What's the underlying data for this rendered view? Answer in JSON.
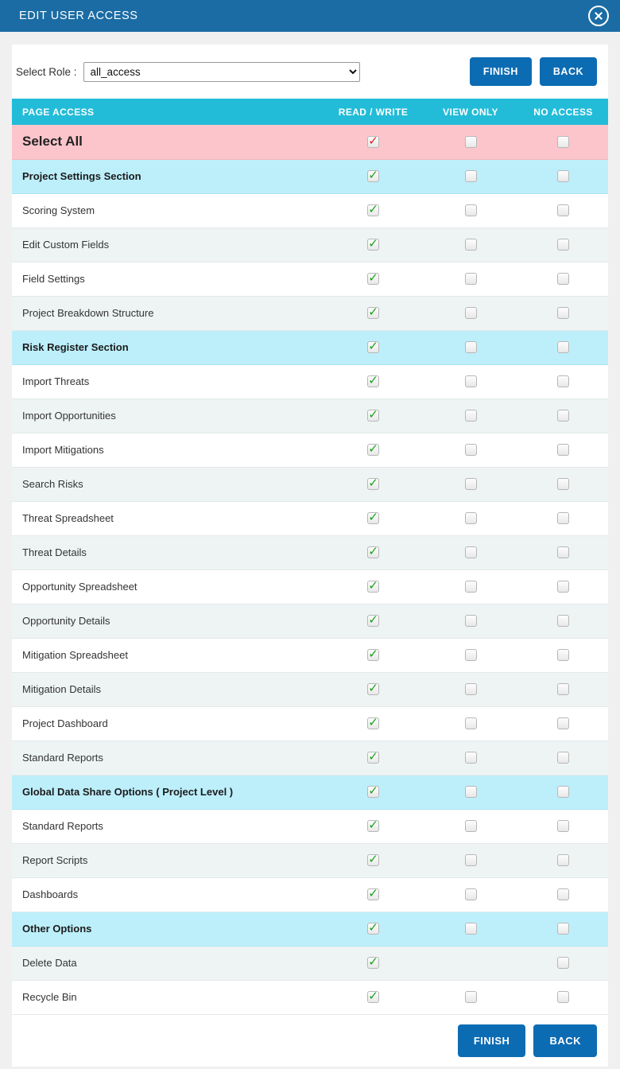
{
  "window": {
    "title": "EDIT USER ACCESS",
    "close_icon": "close-circle-icon",
    "titlebar_color": "#1b6ca4"
  },
  "toolbar": {
    "role_label": "Select Role :",
    "role_value": "all_access",
    "role_options": [
      "all_access"
    ],
    "finish_label": "FINISH",
    "back_label": "BACK",
    "button_color": "#0c6cb3"
  },
  "table": {
    "header_color": "#22bcd8",
    "section_row_color": "#bdeffb",
    "select_all_row_color": "#fbc5cb",
    "columns": [
      "PAGE ACCESS",
      "READ / WRITE",
      "VIEW ONLY",
      "NO ACCESS"
    ],
    "rows": [
      {
        "label": "Select All",
        "kind": "select-all",
        "read_write": true,
        "view_only": false,
        "no_access": false,
        "check_color": "#e02020",
        "has_view_only": true
      },
      {
        "label": "Project Settings Section",
        "kind": "section",
        "read_write": true,
        "view_only": false,
        "no_access": false,
        "check_color": "#18a318",
        "has_view_only": true
      },
      {
        "label": "Scoring System",
        "kind": "item",
        "read_write": true,
        "view_only": false,
        "no_access": false,
        "check_color": "#18a318",
        "has_view_only": true
      },
      {
        "label": "Edit Custom Fields",
        "kind": "item",
        "read_write": true,
        "view_only": false,
        "no_access": false,
        "check_color": "#18a318",
        "has_view_only": true
      },
      {
        "label": "Field Settings",
        "kind": "item",
        "read_write": true,
        "view_only": false,
        "no_access": false,
        "check_color": "#18a318",
        "has_view_only": true
      },
      {
        "label": "Project Breakdown Structure",
        "kind": "item",
        "read_write": true,
        "view_only": false,
        "no_access": false,
        "check_color": "#18a318",
        "has_view_only": true
      },
      {
        "label": "Risk Register Section",
        "kind": "section",
        "read_write": true,
        "view_only": false,
        "no_access": false,
        "check_color": "#18a318",
        "has_view_only": true
      },
      {
        "label": "Import Threats",
        "kind": "item",
        "read_write": true,
        "view_only": false,
        "no_access": false,
        "check_color": "#18a318",
        "has_view_only": true
      },
      {
        "label": "Import Opportunities",
        "kind": "item",
        "read_write": true,
        "view_only": false,
        "no_access": false,
        "check_color": "#18a318",
        "has_view_only": true
      },
      {
        "label": "Import Mitigations",
        "kind": "item",
        "read_write": true,
        "view_only": false,
        "no_access": false,
        "check_color": "#18a318",
        "has_view_only": true
      },
      {
        "label": "Search Risks",
        "kind": "item",
        "read_write": true,
        "view_only": false,
        "no_access": false,
        "check_color": "#18a318",
        "has_view_only": true
      },
      {
        "label": "Threat Spreadsheet",
        "kind": "item",
        "read_write": true,
        "view_only": false,
        "no_access": false,
        "check_color": "#18a318",
        "has_view_only": true
      },
      {
        "label": "Threat Details",
        "kind": "item",
        "read_write": true,
        "view_only": false,
        "no_access": false,
        "check_color": "#18a318",
        "has_view_only": true
      },
      {
        "label": "Opportunity Spreadsheet",
        "kind": "item",
        "read_write": true,
        "view_only": false,
        "no_access": false,
        "check_color": "#18a318",
        "has_view_only": true
      },
      {
        "label": "Opportunity Details",
        "kind": "item",
        "read_write": true,
        "view_only": false,
        "no_access": false,
        "check_color": "#18a318",
        "has_view_only": true
      },
      {
        "label": "Mitigation Spreadsheet",
        "kind": "item",
        "read_write": true,
        "view_only": false,
        "no_access": false,
        "check_color": "#18a318",
        "has_view_only": true
      },
      {
        "label": "Mitigation Details",
        "kind": "item",
        "read_write": true,
        "view_only": false,
        "no_access": false,
        "check_color": "#18a318",
        "has_view_only": true
      },
      {
        "label": "Project Dashboard",
        "kind": "item",
        "read_write": true,
        "view_only": false,
        "no_access": false,
        "check_color": "#18a318",
        "has_view_only": true
      },
      {
        "label": "Standard Reports",
        "kind": "item",
        "read_write": true,
        "view_only": false,
        "no_access": false,
        "check_color": "#18a318",
        "has_view_only": true
      },
      {
        "label": "Global Data Share Options ( Project Level )",
        "kind": "section",
        "read_write": true,
        "view_only": false,
        "no_access": false,
        "check_color": "#18a318",
        "has_view_only": true
      },
      {
        "label": "Standard Reports",
        "kind": "item",
        "read_write": true,
        "view_only": false,
        "no_access": false,
        "check_color": "#18a318",
        "has_view_only": true
      },
      {
        "label": "Report Scripts",
        "kind": "item",
        "read_write": true,
        "view_only": false,
        "no_access": false,
        "check_color": "#18a318",
        "has_view_only": true
      },
      {
        "label": "Dashboards",
        "kind": "item",
        "read_write": true,
        "view_only": false,
        "no_access": false,
        "check_color": "#18a318",
        "has_view_only": true
      },
      {
        "label": "Other Options",
        "kind": "section",
        "read_write": true,
        "view_only": false,
        "no_access": false,
        "check_color": "#18a318",
        "has_view_only": true
      },
      {
        "label": "Delete Data",
        "kind": "item",
        "read_write": true,
        "view_only": null,
        "no_access": false,
        "check_color": "#18a318",
        "has_view_only": false
      },
      {
        "label": "Recycle Bin",
        "kind": "item",
        "read_write": true,
        "view_only": false,
        "no_access": false,
        "check_color": "#18a318",
        "has_view_only": true
      }
    ]
  },
  "footer": {
    "finish_label": "FINISH",
    "back_label": "BACK"
  }
}
